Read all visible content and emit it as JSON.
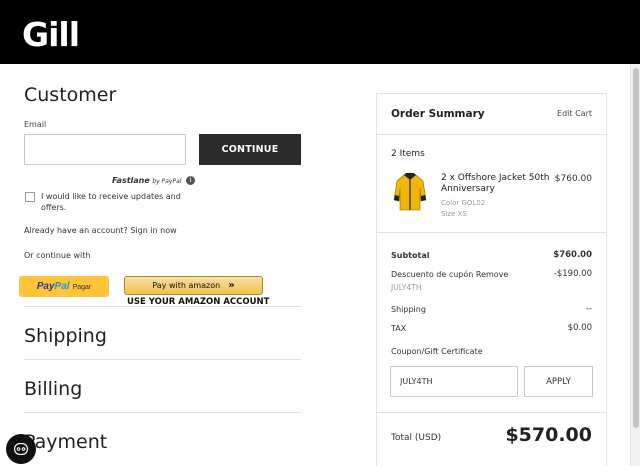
{
  "header": {
    "logo_text": "Gill"
  },
  "customer": {
    "title": "Customer",
    "email_label": "Email",
    "email_value": "",
    "continue_label": "CONTINUE",
    "fastlane_brand": "Fastlane",
    "fastlane_by": "by PayPal",
    "newsletter_label": "I would like to receive updates and offers.",
    "account_text": "Already have an account? Sign in now",
    "or_continue": "Or continue with",
    "paypal_label": "PayPal",
    "paypal_sub": "Pagar",
    "amazon_label": "Pay with amazon",
    "amazon_caption": "USE YOUR AMAZON ACCOUNT"
  },
  "sections": {
    "shipping": "Shipping",
    "billing": "Billing",
    "payment": "Payment"
  },
  "summary": {
    "title": "Order Summary",
    "edit_cart": "Edit Cart",
    "items_count": "2 Items",
    "product": {
      "name": "2 x Offshore Jacket 50th Anniversary",
      "price": "$760.00",
      "color": "Color GOL02",
      "size": "Size XS"
    },
    "subtotal_label": "Subtotal",
    "subtotal_value": "$760.00",
    "discount_label": "Descuento de cupón Remove",
    "discount_code": "JULY4TH",
    "discount_value": "-$190.00",
    "shipping_label": "Shipping",
    "shipping_value": "--",
    "tax_label": "TAX",
    "tax_value": "$0.00",
    "coupon_label": "Coupon/Gift Certificate",
    "coupon_value": "JULY4TH",
    "apply_label": "APPLY",
    "total_label": "Total (USD)",
    "total_value": "$570.00"
  },
  "colors": {
    "header_bg": "#000000",
    "continue_bg": "#2b2b2b",
    "paypal_yellow": "#ffc439",
    "amazon_gold": "#f0c14b"
  }
}
